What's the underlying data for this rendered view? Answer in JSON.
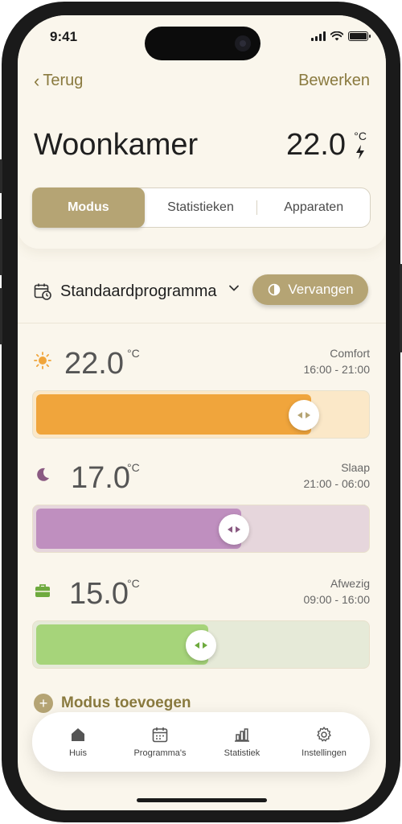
{
  "status": {
    "time": "9:41"
  },
  "nav": {
    "back_label": "Terug",
    "edit_label": "Bewerken"
  },
  "room": {
    "name": "Woonkamer",
    "temperature": "22.0",
    "unit": "°C"
  },
  "tabs": [
    "Modus",
    "Statistieken",
    "Apparaten"
  ],
  "active_tab": "Modus",
  "program": {
    "label": "Standaardprogramma",
    "replace_label": "Vervangen"
  },
  "modes": [
    {
      "name": "Comfort",
      "temperature": "22.0",
      "unit": "°C",
      "time": "16:00 - 21:00",
      "icon": "sun-icon",
      "color": "#f0a53c",
      "track_color": "#fbe8c8",
      "level": 0.83
    },
    {
      "name": "Slaap",
      "temperature": "17.0",
      "unit": "°C",
      "time": "21:00 - 06:00",
      "icon": "moon-icon",
      "color": "#bf8fbf",
      "track_color": "#e6d6dc",
      "level": 0.62
    },
    {
      "name": "Afwezig",
      "temperature": "15.0",
      "unit": "°C",
      "time": "09:00 - 16:00",
      "icon": "briefcase-icon",
      "color": "#a6d47a",
      "track_color": "#e6ead8",
      "level": 0.52
    }
  ],
  "add_mode_label": "Modus toevoegen",
  "tabbar": [
    {
      "label": "Huis",
      "icon": "home-icon"
    },
    {
      "label": "Programma's",
      "icon": "calendar-icon"
    },
    {
      "label": "Statistiek",
      "icon": "bar-chart-icon"
    },
    {
      "label": "Instellingen",
      "icon": "gear-icon"
    }
  ],
  "colors": {
    "accent": "#b5a474",
    "accent_text": "#8a7a3f",
    "background": "#faf6ec"
  }
}
